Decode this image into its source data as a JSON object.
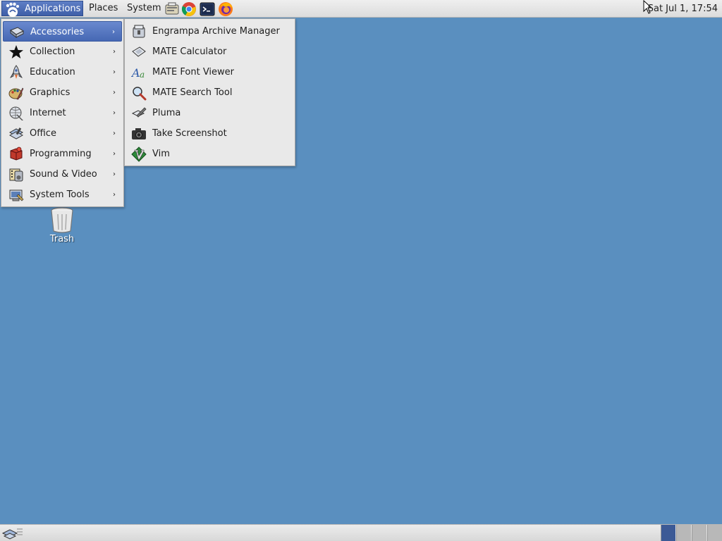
{
  "top_panel": {
    "menus": [
      {
        "label": "Applications"
      },
      {
        "label": "Places"
      },
      {
        "label": "System"
      }
    ],
    "launchers": [
      "file-manager-icon",
      "chrome-icon",
      "terminal-icon",
      "firefox-icon"
    ],
    "clock": "Sat Jul  1, 17:54"
  },
  "applications_menu": {
    "items": [
      {
        "label": "Accessories",
        "icon": "accessories-icon"
      },
      {
        "label": "Collection",
        "icon": "star-icon"
      },
      {
        "label": "Education",
        "icon": "education-icon"
      },
      {
        "label": "Graphics",
        "icon": "graphics-icon"
      },
      {
        "label": "Internet",
        "icon": "internet-icon"
      },
      {
        "label": "Office",
        "icon": "office-icon"
      },
      {
        "label": "Programming",
        "icon": "programming-icon"
      },
      {
        "label": "Sound & Video",
        "icon": "sound-video-icon"
      },
      {
        "label": "System Tools",
        "icon": "system-tools-icon"
      }
    ],
    "arrow": "›",
    "highlighted": "Accessories"
  },
  "accessories_submenu": {
    "items": [
      {
        "label": "Engrampa Archive Manager",
        "icon": "archive-manager-icon"
      },
      {
        "label": "MATE Calculator",
        "icon": "calculator-icon"
      },
      {
        "label": "MATE Font Viewer",
        "icon": "font-viewer-icon"
      },
      {
        "label": "MATE Search Tool",
        "icon": "search-icon"
      },
      {
        "label": "Pluma",
        "icon": "text-editor-icon"
      },
      {
        "label": "Take Screenshot",
        "icon": "camera-icon"
      },
      {
        "label": "Vim",
        "icon": "vim-icon"
      }
    ]
  },
  "desktop": {
    "trash_label": "Trash"
  },
  "colors": {
    "desktop_bg": "#5a8fbf",
    "menu_highlight": "#4a6cb8",
    "panel_bg": "#e4e4e4"
  }
}
